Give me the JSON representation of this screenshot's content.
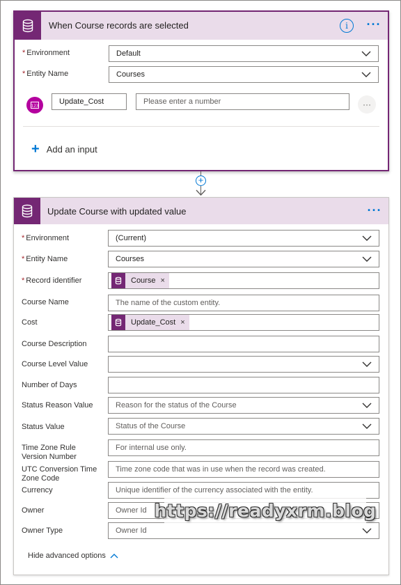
{
  "trigger_card": {
    "title": "When Course records are selected",
    "info_icon": "i",
    "more_icon": "···",
    "fields": {
      "environment": {
        "label": "Environment",
        "value": "Default"
      },
      "entity_name": {
        "label": "Entity Name",
        "value": "Courses"
      }
    },
    "input_row": {
      "badge_icon": "number-input-icon",
      "name": "Update_Cost",
      "placeholder": "Please enter a number",
      "more_icon": "···"
    },
    "add_input_label": "Add an input",
    "add_input_icon": "+"
  },
  "connector": {
    "add_icon": "+"
  },
  "action_card": {
    "title": "Update Course with updated value",
    "more_icon": "···",
    "fields": {
      "environment": {
        "label": "Environment",
        "value": "(Current)"
      },
      "entity_name": {
        "label": "Entity Name",
        "value": "Courses"
      },
      "record_identifier": {
        "label": "Record identifier",
        "token": "Course"
      },
      "course_name": {
        "label": "Course Name",
        "placeholder": "The name of the custom entity."
      },
      "cost": {
        "label": "Cost",
        "token": "Update_Cost"
      },
      "course_description": {
        "label": "Course Description",
        "value": ""
      },
      "course_level_value": {
        "label": "Course Level Value",
        "value": ""
      },
      "number_of_days": {
        "label": "Number of Days",
        "value": ""
      },
      "status_reason_value": {
        "label": "Status Reason Value",
        "placeholder": "Reason for the status of the Course"
      },
      "status_value": {
        "label": "Status Value",
        "placeholder": "Status of the Course"
      },
      "time_zone_rule_version_number": {
        "label": "Time Zone Rule Version Number",
        "placeholder": "For internal use only."
      },
      "utc_conversion_time_zone_code": {
        "label": "UTC Conversion Time Zone Code",
        "placeholder": "Time zone code that was in use when the record was created."
      },
      "currency": {
        "label": "Currency",
        "placeholder": "Unique identifier of the currency associated with the entity."
      },
      "owner": {
        "label": "Owner",
        "placeholder": "Owner Id"
      },
      "owner_type": {
        "label": "Owner Type",
        "placeholder": "Owner Id"
      }
    },
    "token_remove_icon": "×",
    "hide_advanced_label": "Hide advanced options",
    "hide_advanced_icon": "^"
  },
  "watermark": "https://readyxrm.blog",
  "colors": {
    "brand_purple": "#742774",
    "header_lavender": "#eadcea",
    "accent_blue": "#0078d4",
    "required_red": "#a4262c",
    "badge_magenta": "#b4009e"
  }
}
